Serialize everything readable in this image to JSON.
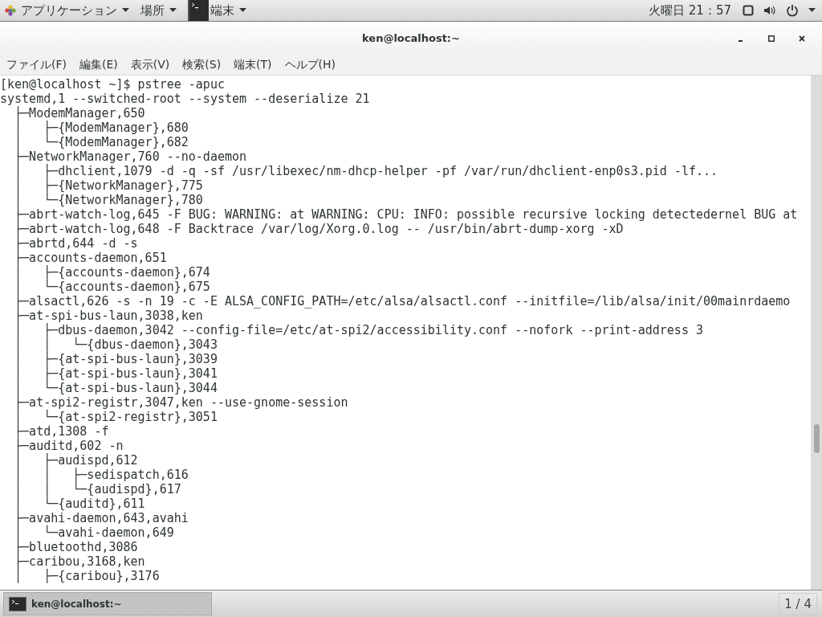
{
  "top_bar": {
    "menus": [
      {
        "label": "アプリケーション",
        "kind": "apps"
      },
      {
        "label": "場所",
        "kind": "plain"
      },
      {
        "label": "端末",
        "kind": "terminal"
      }
    ],
    "clock": "火曜日 21：57"
  },
  "window": {
    "title": "ken@localhost:~"
  },
  "menu_bar": [
    "ファイル(F)",
    "編集(E)",
    "表示(V)",
    "検索(S)",
    "端末(T)",
    "ヘルプ(H)"
  ],
  "terminal": {
    "lines": [
      "[ken@localhost ~]$ pstree -apuc",
      "systemd,1 --switched-root --system --deserialize 21",
      "  ├─ModemManager,650",
      "  │   ├─{ModemManager},680",
      "  │   └─{ModemManager},682",
      "  ├─NetworkManager,760 --no-daemon",
      "  │   ├─dhclient,1079 -d -q -sf /usr/libexec/nm-dhcp-helper -pf /var/run/dhclient-enp0s3.pid -lf...",
      "  │   ├─{NetworkManager},775",
      "  │   └─{NetworkManager},780",
      "  ├─abrt-watch-log,645 -F BUG: WARNING: at WARNING: CPU: INFO: possible recursive locking detectedernel BUG at",
      "  ├─abrt-watch-log,648 -F Backtrace /var/log/Xorg.0.log -- /usr/bin/abrt-dump-xorg -xD",
      "  ├─abrtd,644 -d -s",
      "  ├─accounts-daemon,651",
      "  │   ├─{accounts-daemon},674",
      "  │   └─{accounts-daemon},675",
      "  ├─alsactl,626 -s -n 19 -c -E ALSA_CONFIG_PATH=/etc/alsa/alsactl.conf --initfile=/lib/alsa/init/00mainrdaemo",
      "  ├─at-spi-bus-laun,3038,ken",
      "  │   ├─dbus-daemon,3042 --config-file=/etc/at-spi2/accessibility.conf --nofork --print-address 3",
      "  │   │   └─{dbus-daemon},3043",
      "  │   ├─{at-spi-bus-laun},3039",
      "  │   ├─{at-spi-bus-laun},3041",
      "  │   └─{at-spi-bus-laun},3044",
      "  ├─at-spi2-registr,3047,ken --use-gnome-session",
      "  │   └─{at-spi2-registr},3051",
      "  ├─atd,1308 -f",
      "  ├─auditd,602 -n",
      "  │   ├─audispd,612",
      "  │   │   ├─sedispatch,616",
      "  │   │   └─{audispd},617",
      "  │   └─{auditd},611",
      "  ├─avahi-daemon,643,avahi",
      "  │   └─avahi-daemon,649",
      "  ├─bluetoothd,3086",
      "  ├─caribou,3168,ken",
      "  │   ├─{caribou},3176"
    ]
  },
  "taskbar": {
    "tasks": [
      {
        "label": "ken@localhost:~"
      }
    ],
    "workspace": "1 / 4"
  }
}
